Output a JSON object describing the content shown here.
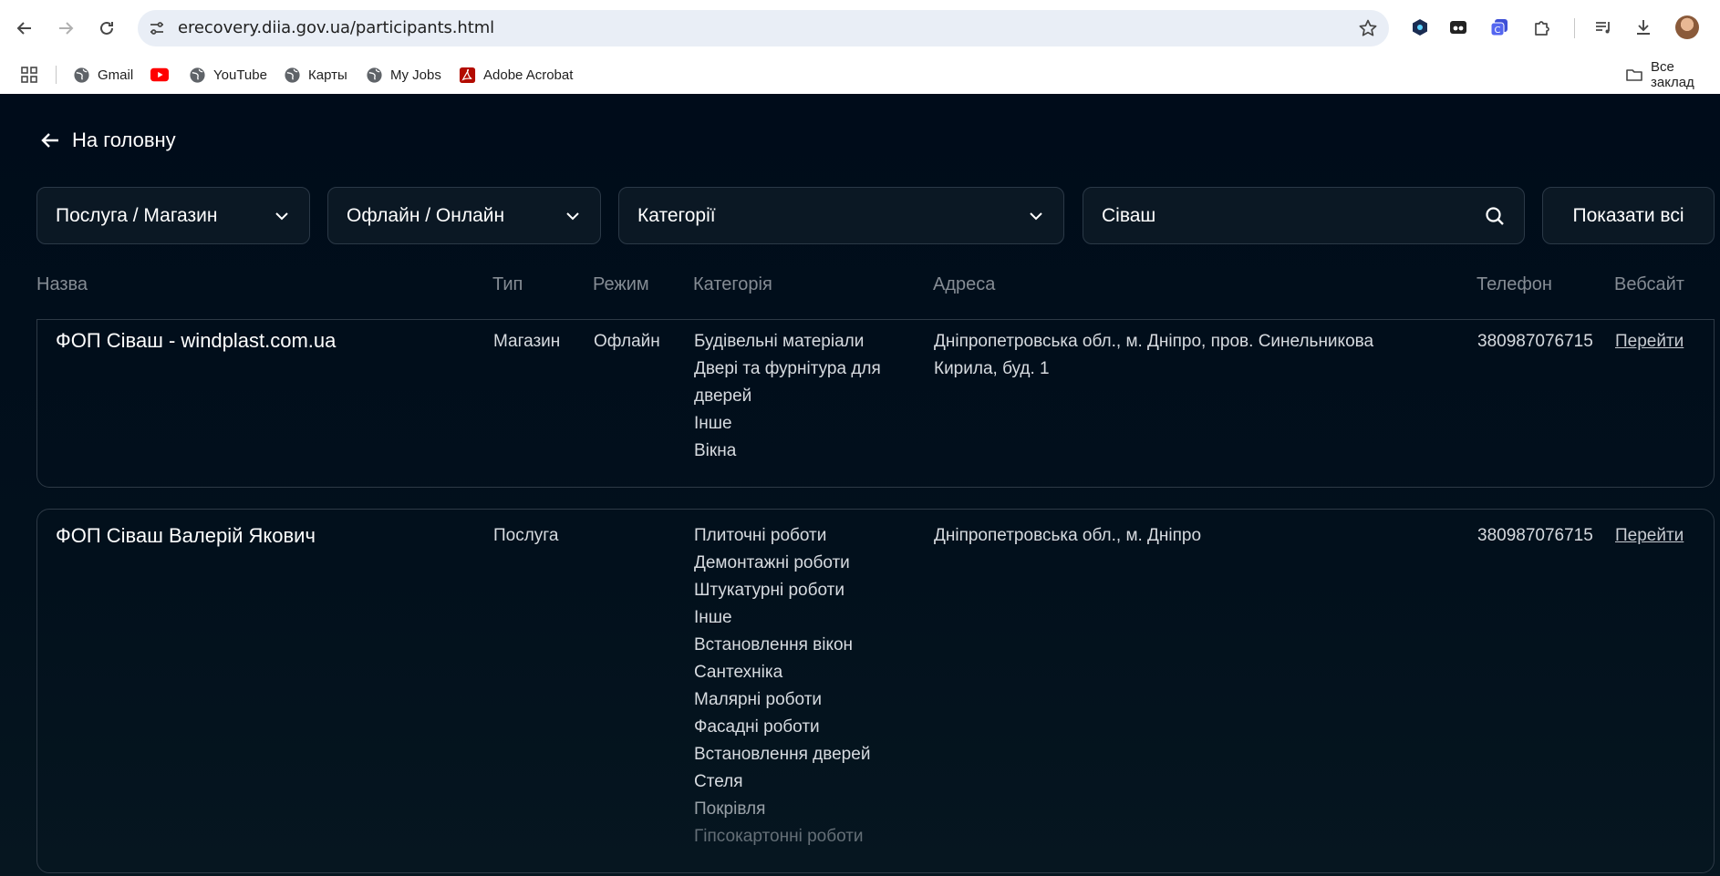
{
  "browser": {
    "url": "erecovery.diia.gov.ua/participants.html",
    "bookmarks": [
      {
        "label": "Gmail",
        "icon": "globe-icon"
      },
      {
        "label": "",
        "icon": "youtube-icon"
      },
      {
        "label": "YouTube",
        "icon": "globe-icon"
      },
      {
        "label": "Карты",
        "icon": "globe-icon"
      },
      {
        "label": "My Jobs",
        "icon": "globe-icon"
      },
      {
        "label": "Adobe Acrobat",
        "icon": "acrobat-icon"
      }
    ],
    "all_bookmarks": "Все заклад"
  },
  "page": {
    "back_label": "На головну",
    "filters": {
      "type": "Послуга / Магазин",
      "mode": "Офлайн / Онлайн",
      "categories": "Категорії",
      "search_value": "Сіваш",
      "show_all": "Показати всі"
    },
    "columns": {
      "name": "Назва",
      "type": "Тип",
      "mode": "Режим",
      "category": "Категорія",
      "address": "Адреса",
      "phone": "Телефон",
      "website": "Вебсайт"
    },
    "rows": [
      {
        "name": "ФОП Сіваш - windplast.com.ua",
        "type": "Магазин",
        "mode": "Офлайн",
        "categories": [
          "Будівельні матеріали",
          "Двері та фурнітура для",
          "дверей",
          "Інше",
          "Вікна"
        ],
        "address": [
          "Дніпропетровська обл., м. Дніпро, пров. Синельникова",
          "Кирила, буд. 1"
        ],
        "phone": "380987076715",
        "website": "Перейти"
      },
      {
        "name": "ФОП Сіваш Валерій Якович",
        "type": "Послуга",
        "mode": "",
        "categories": [
          "Плиточні роботи",
          "Демонтажні роботи",
          "Штукатурні роботи",
          "Інше",
          "Встановлення вікон",
          "Сантехніка",
          "Малярні роботи",
          "Фасадні роботи",
          "Встановлення дверей",
          "Стеля",
          "Покрівля",
          "Гіпсокартонні роботи"
        ],
        "address": [
          "Дніпропетровська обл., м. Дніпро"
        ],
        "phone": "380987076715",
        "website": "Перейти"
      }
    ]
  },
  "colors": {
    "page_bg": "#000c1a",
    "border": "#2e3a46",
    "header_text": "#858c94"
  }
}
